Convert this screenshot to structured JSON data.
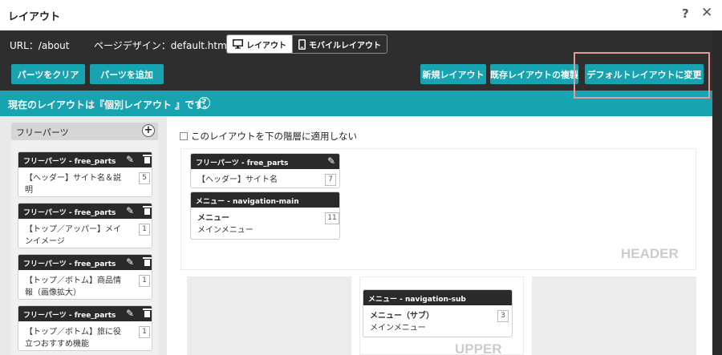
{
  "title": "レイアウト",
  "titlebar": {
    "help": "?",
    "close": "✕"
  },
  "toolbar": {
    "url_label": "URL：/about",
    "design_label": "ページデザイン：default.htm",
    "view_layout": "レイアウト",
    "view_mobile": "モバイルレイアウト",
    "clear_parts": "パーツをクリア",
    "add_parts": "パーツを追加",
    "new_layout": "新規レイアウト",
    "copy_layout": "既存レイアウトの複製",
    "change_default": "デフォルトレイアウトに変更"
  },
  "info": {
    "text": "現在のレイアウトは『個別レイアウト 』です。",
    "help": "?"
  },
  "free_parts": {
    "title": "フリーパーツ",
    "add": "+",
    "items": [
      {
        "head": "フリーパーツ - free_parts",
        "line1": "【ヘッダー】サイト名＆説",
        "line2": "明",
        "num": "5"
      },
      {
        "head": "フリーパーツ - free_parts",
        "line1": "【トップ／アッパー】メイ",
        "line2": "ンイメージ",
        "num": "1"
      },
      {
        "head": "フリーパーツ - free_parts",
        "line1": "【トップ／ボトム】商品情",
        "line2": "報（画像拡大）",
        "num": "1"
      },
      {
        "head": "フリーパーツ - free_parts",
        "line1": "【トップ／ボトム】旅に役",
        "line2": "立つおすすめ機能",
        "num": "1"
      }
    ]
  },
  "layout": {
    "no_apply_label": "このレイアウトを下の階層に適用しない",
    "header_label": "HEADER",
    "upper_label": "UPPER",
    "header_parts": [
      {
        "head": "フリーパーツ - free_parts",
        "line1": "【ヘッダー】サイト名",
        "line2": "",
        "num": "7"
      },
      {
        "head": "メニュー - navigation-main",
        "line1": "メニュー",
        "line2": "メインメニュー",
        "num": "11"
      }
    ],
    "upper_parts": [
      {
        "head": "メニュー - navigation-sub",
        "line1": "メニュー（サブ）",
        "line2": "メインメニュー",
        "num": "3"
      }
    ]
  },
  "colors": {
    "accent": "#17a3b0",
    "dark": "#2e2e2e",
    "highlight": "#e59a9a"
  }
}
